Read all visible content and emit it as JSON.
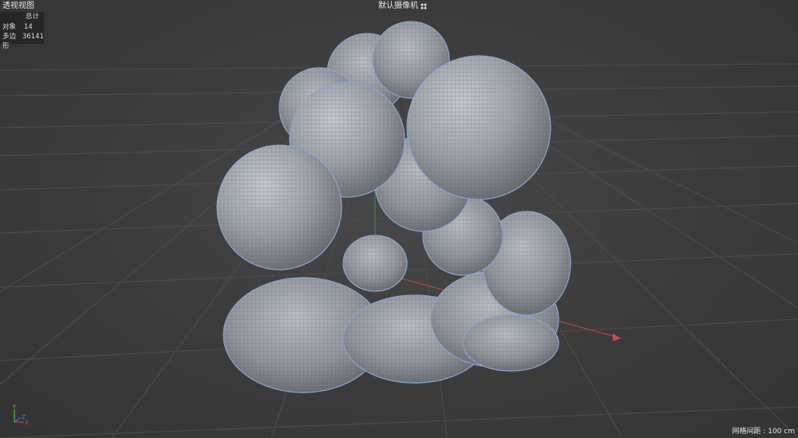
{
  "viewport": {
    "view_name": "透视视图",
    "camera_name": "默认摄像机",
    "camera_icon": "camera-settings-icon",
    "grid_spacing": "网格间距 : 100 cm"
  },
  "stats": {
    "header": "总计",
    "rows": [
      {
        "label": "对象",
        "value": "14"
      },
      {
        "label": "多边形",
        "value": "36141"
      }
    ]
  },
  "axis": {
    "x_label": "X",
    "y_label": "Y",
    "z_label": "Z",
    "x_color": "#e04a4a",
    "y_color": "#5ecf5e",
    "z_color": "#4a7bd8"
  },
  "colors": {
    "background": "#3a3a3a",
    "grid": "#4d4d4d",
    "mesh": "#a3a7ad",
    "mesh_outline": "#8fa8d8"
  }
}
